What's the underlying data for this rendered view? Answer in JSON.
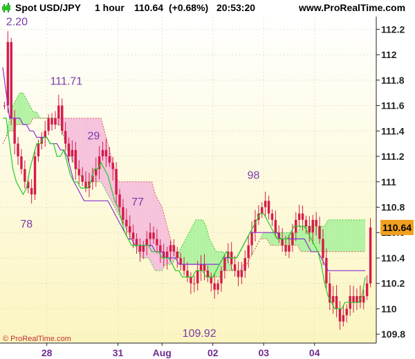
{
  "header": {
    "symbol": "Spot USD/JPY",
    "timeframe": "1 hour",
    "last": "110.64",
    "change": "(+0.68%)",
    "time": "20:53:20",
    "site": "www.ProRealTime.com"
  },
  "footer": {
    "copyright": "© ProRealTime.com"
  },
  "colors": {
    "candle": "#d41c4a",
    "tenkan": "#1fcc1f",
    "kijun": "#8a2fd0",
    "cloud_bull": "#b3f2a3",
    "cloud_bear": "#f6c2dc",
    "axis_bg": "#ffffff",
    "price_tag": "#f0a020"
  },
  "chart_data": {
    "type": "candlestick",
    "title": "Spot USD/JPY 1 hour",
    "ylim": [
      109.73,
      112.3
    ],
    "y_ticks": [
      109.8,
      110,
      110.2,
      110.4,
      110.6,
      110.8,
      111,
      111.2,
      111.4,
      111.6,
      111.8,
      112,
      112.2
    ],
    "y_tick_labels": [
      "109.8",
      "110",
      "110.2",
      "110.4",
      "110.6",
      "110.8",
      "111",
      "111.2",
      "111.4",
      "111.6",
      "111.8",
      "112",
      "112.2"
    ],
    "x_labels": [
      "28",
      "31",
      "Aug",
      "02",
      "03",
      "04"
    ],
    "last_price": "110.64",
    "annotations": [
      {
        "text": "2.20",
        "value": 112.2
      },
      {
        "text": "111.71",
        "value": 111.71
      },
      {
        "text": "29",
        "value": 111.29
      },
      {
        "text": "78",
        "value": 110.78
      },
      {
        "text": "77",
        "value": 110.77
      },
      {
        "text": "98",
        "value": 110.98
      },
      {
        "text": "109.92",
        "value": 109.92
      }
    ],
    "series": [
      {
        "name": "price",
        "values": [
          111.6,
          112.1,
          111.5,
          111.3,
          111.2,
          111.1,
          111.0,
          110.95,
          110.9,
          111.2,
          111.3,
          111.35,
          111.4,
          111.5,
          111.45,
          111.5,
          111.6,
          111.4,
          111.3,
          111.2,
          111.25,
          111.1,
          111.05,
          111.0,
          110.95,
          111.0,
          111.05,
          111.1,
          111.2,
          111.25,
          111.2,
          111.15,
          111.1,
          110.9,
          110.8,
          110.7,
          110.65,
          110.6,
          110.55,
          110.5,
          110.45,
          110.5,
          110.55,
          110.6,
          110.55,
          110.5,
          110.45,
          110.4,
          110.45,
          110.5,
          110.45,
          110.4,
          110.35,
          110.3,
          110.25,
          110.2,
          110.2,
          110.3,
          110.35,
          110.3,
          110.25,
          110.2,
          110.15,
          110.2,
          110.3,
          110.4,
          110.45,
          110.35,
          110.3,
          110.25,
          110.3,
          110.4,
          110.5,
          110.6,
          110.7,
          110.75,
          110.8,
          110.85,
          110.75,
          110.7,
          110.6,
          110.55,
          110.5,
          110.45,
          110.5,
          110.6,
          110.7,
          110.75,
          110.7,
          110.65,
          110.6,
          110.7,
          110.65,
          110.55,
          110.4,
          110.2,
          110.05,
          110.1,
          110.0,
          109.9,
          109.95,
          110.0,
          110.1,
          110.05,
          110.1,
          110.05,
          110.1,
          110.2,
          110.64
        ]
      },
      {
        "name": "tenkan",
        "values": [
          111.5,
          111.5,
          111.3,
          111.1,
          111.0,
          110.95,
          110.9,
          110.95,
          111.1,
          111.2,
          111.3,
          111.3,
          111.35,
          111.35,
          111.3,
          111.3,
          111.2,
          111.2,
          111.25,
          111.15,
          111.05,
          111.0,
          111.0,
          110.95,
          110.95,
          110.95,
          111.0,
          111.1,
          111.1,
          111.15,
          111.1,
          111.05,
          110.95,
          110.85,
          110.8,
          110.7,
          110.6,
          110.55,
          110.5,
          110.5,
          110.5,
          110.5,
          110.5,
          110.5,
          110.45,
          110.45,
          110.45,
          110.4,
          110.4,
          110.4,
          110.35,
          110.3,
          110.3,
          110.25,
          110.25,
          110.25,
          110.25,
          110.3,
          110.3,
          110.3,
          110.25,
          110.25,
          110.25,
          110.3,
          110.35,
          110.4,
          110.45,
          110.4,
          110.4,
          110.4,
          110.45,
          110.5,
          110.55,
          110.6,
          110.65,
          110.7,
          110.75,
          110.75,
          110.7,
          110.65,
          110.6,
          110.55,
          110.55,
          110.55,
          110.55,
          110.6,
          110.65,
          110.65,
          110.65,
          110.65,
          110.6,
          110.55,
          110.5,
          110.45,
          110.35,
          110.2,
          110.1,
          110.05,
          110.0,
          110.0,
          110.0,
          110.05,
          110.05,
          110.05,
          110.05,
          110.05,
          110.1,
          110.25
        ]
      },
      {
        "name": "kijun",
        "values": [
          111.9,
          111.7,
          111.5,
          111.5,
          111.5,
          111.5,
          111.45,
          111.45,
          111.4,
          111.4,
          111.35,
          111.35,
          111.35,
          111.35,
          111.3,
          111.3,
          111.3,
          111.25,
          111.25,
          111.2,
          111.1,
          111.0,
          110.95,
          110.9,
          110.85,
          110.85,
          110.85,
          110.85,
          110.85,
          110.85,
          110.85,
          110.85,
          110.8,
          110.75,
          110.7,
          110.65,
          110.6,
          110.55,
          110.55,
          110.5,
          110.5,
          110.5,
          110.5,
          110.5,
          110.5,
          110.45,
          110.45,
          110.45,
          110.4,
          110.4,
          110.4,
          110.4,
          110.35,
          110.35,
          110.35,
          110.35,
          110.35,
          110.35,
          110.35,
          110.35,
          110.35,
          110.35,
          110.35,
          110.35,
          110.35,
          110.4,
          110.4,
          110.4,
          110.4,
          110.4,
          110.45,
          110.5,
          110.55,
          110.6,
          110.6,
          110.6,
          110.6,
          110.6,
          110.6,
          110.6,
          110.6,
          110.6,
          110.55,
          110.55,
          110.55,
          110.55,
          110.55,
          110.55,
          110.55,
          110.55,
          110.5,
          110.45,
          110.45,
          110.45,
          110.4,
          110.35,
          110.3,
          110.3,
          110.3,
          110.3,
          110.3,
          110.3,
          110.3,
          110.3,
          110.3,
          110.3,
          110.3,
          110.3
        ]
      },
      {
        "name": "span_a",
        "values": [
          111.3,
          111.35,
          111.5,
          111.6,
          111.65,
          111.7,
          111.7,
          111.65,
          111.6,
          111.55,
          111.55,
          111.5,
          111.5,
          111.5,
          111.5,
          111.5,
          111.45,
          111.45,
          111.35,
          111.25,
          111.2,
          111.15,
          111.1,
          111.05,
          111.0,
          111.0,
          111.0,
          111.0,
          111.0,
          111.0,
          110.95,
          110.9,
          110.85,
          110.8,
          110.75,
          110.7,
          110.65,
          110.6,
          110.55,
          110.5,
          110.45,
          110.4,
          110.4,
          110.4,
          110.35,
          110.3,
          110.3,
          110.3,
          110.35,
          110.35,
          110.35,
          110.4,
          110.45,
          110.5,
          110.55,
          110.6,
          110.65,
          110.7,
          110.7,
          110.7,
          110.65,
          110.55,
          110.5,
          110.45,
          110.45,
          110.45,
          110.4,
          110.35,
          110.3,
          110.3,
          110.3,
          110.3,
          110.35,
          110.4,
          110.45,
          110.5,
          110.55,
          110.6,
          110.6,
          110.6,
          110.6,
          110.6,
          110.6,
          110.6,
          110.6,
          110.6,
          110.6,
          110.6,
          110.65,
          110.65,
          110.65,
          110.65,
          110.65,
          110.65,
          110.65,
          110.65,
          110.7,
          110.7,
          110.7,
          110.7,
          110.7,
          110.7,
          110.7,
          110.7,
          110.7,
          110.7,
          110.7,
          110.7
        ]
      },
      {
        "name": "span_b",
        "values": [
          111.3,
          111.35,
          111.4,
          111.4,
          111.45,
          111.45,
          111.45,
          111.45,
          111.45,
          111.5,
          111.5,
          111.5,
          111.5,
          111.5,
          111.5,
          111.5,
          111.5,
          111.5,
          111.5,
          111.5,
          111.5,
          111.5,
          111.5,
          111.5,
          111.5,
          111.5,
          111.5,
          111.5,
          111.5,
          111.5,
          111.4,
          111.3,
          111.2,
          111.1,
          111.0,
          111.0,
          111.0,
          111.0,
          111.0,
          111.0,
          111.0,
          111.0,
          111.0,
          111.0,
          111.0,
          110.9,
          110.85,
          110.8,
          110.7,
          110.6,
          110.5,
          110.45,
          110.4,
          110.35,
          110.35,
          110.35,
          110.35,
          110.35,
          110.35,
          110.35,
          110.3,
          110.25,
          110.25,
          110.25,
          110.25,
          110.3,
          110.3,
          110.3,
          110.3,
          110.3,
          110.3,
          110.35,
          110.35,
          110.4,
          110.45,
          110.5,
          110.55,
          110.55,
          110.55,
          110.5,
          110.5,
          110.5,
          110.5,
          110.5,
          110.5,
          110.5,
          110.5,
          110.5,
          110.45,
          110.45,
          110.45,
          110.45,
          110.45,
          110.45,
          110.45,
          110.45,
          110.45,
          110.45,
          110.45,
          110.45,
          110.45,
          110.45,
          110.45,
          110.45,
          110.45,
          110.45,
          110.45,
          110.45
        ]
      }
    ]
  }
}
